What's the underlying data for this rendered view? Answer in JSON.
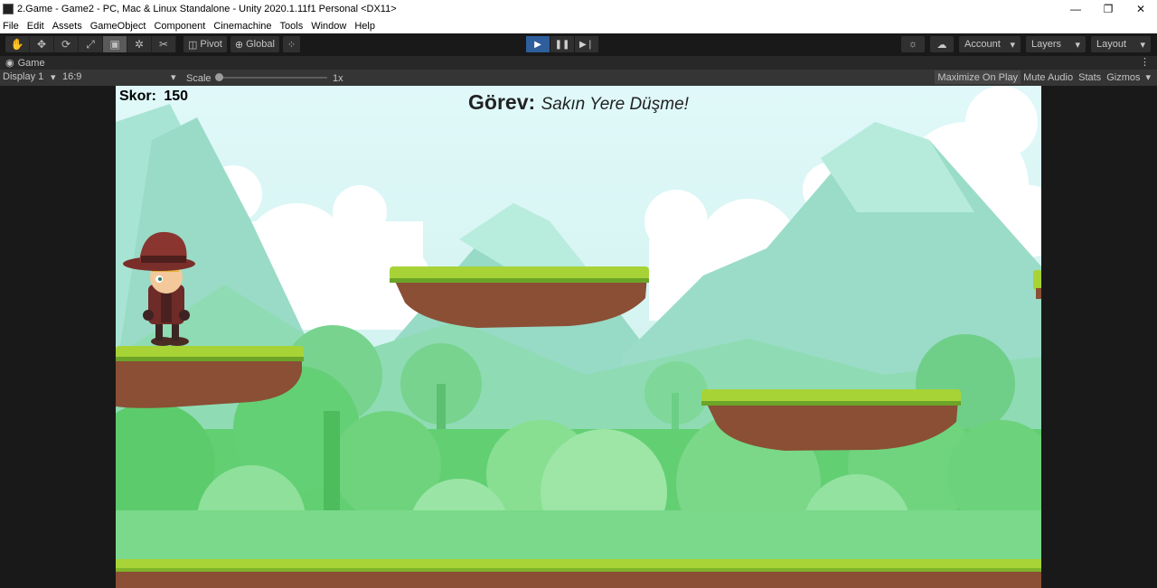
{
  "window": {
    "title": "2.Game - Game2 - PC, Mac & Linux Standalone - Unity 2020.1.11f1 Personal <DX11>",
    "minimize": "—",
    "maximize": "❐",
    "close": "✕"
  },
  "menu": [
    "File",
    "Edit",
    "Assets",
    "GameObject",
    "Component",
    "Cinemachine",
    "Tools",
    "Window",
    "Help"
  ],
  "toolbar": {
    "pivot": "Pivot",
    "global": "Global",
    "account": "Account",
    "layers": "Layers",
    "layout": "Layout"
  },
  "tab": {
    "name": "Game"
  },
  "gamebar": {
    "display": "Display 1",
    "aspect": "16:9",
    "scale_label": "Scale",
    "scale_value": "1x",
    "maximize_on_play": "Maximize On Play",
    "mute_audio": "Mute Audio",
    "stats": "Stats",
    "gizmos": "Gizmos"
  },
  "hud": {
    "score_label": "Skor:",
    "score_value": "150",
    "mission_label": "Görev:",
    "mission_text": "Sakın Yere Düşme!"
  },
  "colors": {
    "play_active": "#2f5e9c",
    "sky": "#d9f5f6",
    "grass": "#a7d336",
    "dirt": "#8a4f35"
  }
}
